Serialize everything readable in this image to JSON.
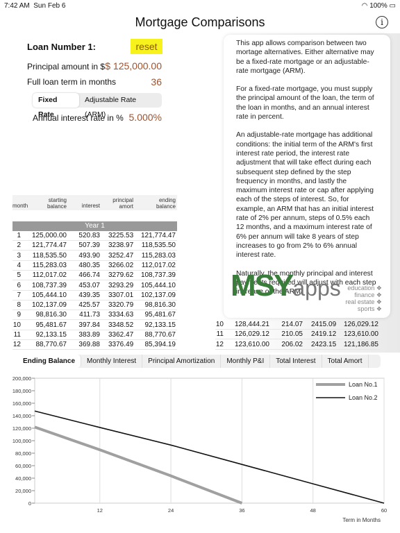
{
  "status": {
    "time": "7:42 AM",
    "date": "Sun Feb 6",
    "battery": "100%"
  },
  "header": {
    "title": "Mortgage Comparisons",
    "info": "i"
  },
  "loan": {
    "title": "Loan Number 1:",
    "reset": "reset",
    "principal_label": "Principal amount in $",
    "principal": "$ 125,000.00",
    "term_label": "Full loan term in months",
    "term": "36",
    "rate_types": [
      "Fixed Rate",
      "Adjustable Rate (ARM)"
    ],
    "rate_label": "Annual interest rate in %",
    "rate": "5.000%"
  },
  "table": {
    "headers": [
      "month",
      "starting balance",
      "interest",
      "principal amort",
      "ending balance"
    ],
    "year": "Year 1",
    "rows": [
      [
        "1",
        "125,000.00",
        "520.83",
        "3225.53",
        "121,774.47"
      ],
      [
        "2",
        "121,774.47",
        "507.39",
        "3238.97",
        "118,535.50"
      ],
      [
        "3",
        "118,535.50",
        "493.90",
        "3252.47",
        "115,283.03"
      ],
      [
        "4",
        "115,283.03",
        "480.35",
        "3266.02",
        "112,017.02"
      ],
      [
        "5",
        "112,017.02",
        "466.74",
        "3279.62",
        "108,737.39"
      ],
      [
        "6",
        "108,737.39",
        "453.07",
        "3293.29",
        "105,444.10"
      ],
      [
        "7",
        "105,444.10",
        "439.35",
        "3307.01",
        "102,137.09"
      ],
      [
        "8",
        "102,137.09",
        "425.57",
        "3320.79",
        "98,816.30"
      ],
      [
        "9",
        "98,816.30",
        "411.73",
        "3334.63",
        "95,481.67"
      ],
      [
        "10",
        "95,481.67",
        "397.84",
        "3348.52",
        "92,133.15"
      ],
      [
        "11",
        "92,133.15",
        "383.89",
        "3362.47",
        "88,770.67"
      ],
      [
        "12",
        "88,770.67",
        "369.88",
        "3376.49",
        "85,394.19"
      ]
    ]
  },
  "table2": {
    "rows": [
      [
        "10",
        "128,444.21",
        "214.07",
        "2415.09",
        "126,029.12"
      ],
      [
        "11",
        "126,029.12",
        "210.05",
        "2419.12",
        "123,610.00"
      ],
      [
        "12",
        "123,610.00",
        "206.02",
        "2423.15",
        "121,186.85"
      ]
    ]
  },
  "popover": {
    "paragraphs": [
      "This app allows comparison between two mortage alternatives. Either alternative may be a fixed-rate mortgage or an adjustable-rate mortgage (ARM).",
      "For a fixed-rate mortgage, you must supply the principal amount of the loan, the term of the loan in months, and an annual interest rate in percent.",
      "An adjustable-rate mortgage has additional conditions: the initial term of the ARM's first interest rate period, the interest rate adjustment that will take effect during each subsequent step defined by the step frequency in months, and lastly the maximum interest rate or cap after applying each of the steps of interest. So, for example, an ARM that has an initial interest rate of 2% per annum, steps of 0.5% each 12 months, and a maximum interest rate of 6% per annum will take 8 years of step increases to go from 2% to 6% annual interest rate.",
      "Naturally, the monthly principal and interest payments required will adjust with each step increase of the ARM."
    ],
    "logo": {
      "text": "MSYapps",
      "tags": [
        "education ❖",
        "finance ❖",
        "real estate ❖",
        "sports ❖"
      ],
      "color": "#3a7d3a"
    }
  },
  "tabs": [
    "Ending Balance",
    "Monthly Interest",
    "Principal Amortization",
    "Monthly P&I",
    "Total Interest",
    "Total Amort"
  ],
  "chart_data": {
    "type": "line",
    "xlabel": "Term in Months",
    "xlim": [
      1,
      60
    ],
    "ylim": [
      0,
      200000
    ],
    "xticks": [
      12,
      24,
      36,
      48,
      60
    ],
    "yticks": [
      "0",
      "20,000",
      "40,000",
      "60,000",
      "80,000",
      "100,000",
      "120,000",
      "140,000",
      "160,000",
      "180,000",
      "200,000"
    ],
    "legend": "top-right",
    "grid": true,
    "series": [
      {
        "name": "Loan No.1",
        "color": "#a0a0a0",
        "x": [
          1,
          12,
          24,
          36
        ],
        "y": [
          121774,
          85394,
          43700,
          0
        ]
      },
      {
        "name": "Loan No.2",
        "color": "#111111",
        "x": [
          1,
          12,
          24,
          36,
          48,
          60
        ],
        "y": [
          147500,
          121187,
          93000,
          62000,
          31000,
          0
        ]
      }
    ]
  }
}
